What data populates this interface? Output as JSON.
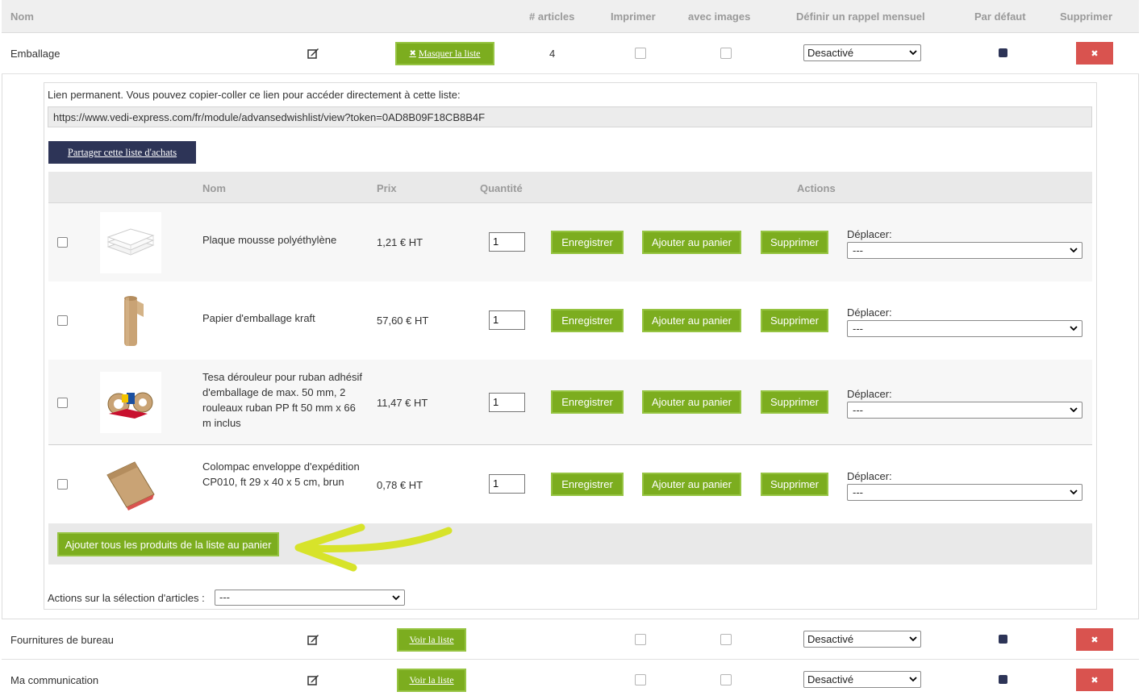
{
  "header": {
    "col_nom": "Nom",
    "col_articles": "# articles",
    "col_imprimer": "Imprimer",
    "col_images": "avec images",
    "col_rappel": "Définir un rappel mensuel",
    "col_defaut": "Par défaut",
    "col_supprimer": "Supprimer"
  },
  "lists": [
    {
      "name": "Emballage",
      "toggle_label": "Masquer la liste",
      "count": "4",
      "reminder": "Desactivé",
      "delete_label": "✖"
    },
    {
      "name": "Fournitures de bureau",
      "toggle_label": "Voir la liste",
      "count": "",
      "reminder": "Desactivé",
      "delete_label": "✖"
    },
    {
      "name": "Ma communication",
      "toggle_label": "Voir la liste",
      "count": "",
      "reminder": "Desactivé",
      "delete_label": "✖"
    }
  ],
  "toggle_icon": "✖",
  "panel": {
    "permalink_label": "Lien permanent. Vous pouvez copier-coller ce lien pour accéder directement à cette liste:",
    "permalink_url": "https://www.vedi-express.com/fr/module/advansedwishlist/view?token=0AD8B09F18CB8B4F",
    "share_label": "Partager cette liste d'achats",
    "table_head": {
      "nom": "Nom",
      "prix": "Prix",
      "quantite": "Quantité",
      "actions": "Actions"
    },
    "products": [
      {
        "name": "Plaque mousse polyéthylène",
        "price": "1,21 € HT",
        "qty": "1",
        "image": "foam-sheets-image"
      },
      {
        "name": "Papier d'emballage kraft",
        "price": "57,60 € HT",
        "qty": "1",
        "image": "kraft-paper-roll-image"
      },
      {
        "name": "Tesa dérouleur pour ruban adhésif d'emballage de max. 50 mm, 2 rouleaux ruban PP ft 50 mm x 66 m inclus",
        "price": "11,47 € HT",
        "qty": "1",
        "image": "tape-dispenser-image"
      },
      {
        "name": "Colompac enveloppe d'expédition CP010, ft 29 x 40 x 5 cm, brun",
        "price": "0,78 € HT",
        "qty": "1",
        "image": "shipping-envelope-image"
      }
    ],
    "btn_save": "Enregistrer",
    "btn_add_cart": "Ajouter au panier",
    "btn_delete": "Supprimer",
    "move_label": "Déplacer:",
    "move_value": "---",
    "add_all_label": "Ajouter tous les produits de la liste au panier",
    "selection_actions_label": "Actions sur la sélection d'articles :",
    "selection_actions_value": "---"
  },
  "colors": {
    "green": "#7cad1f",
    "navy": "#2d3457",
    "red": "#d9534f",
    "annotation_arrow": "#d7e32a"
  }
}
